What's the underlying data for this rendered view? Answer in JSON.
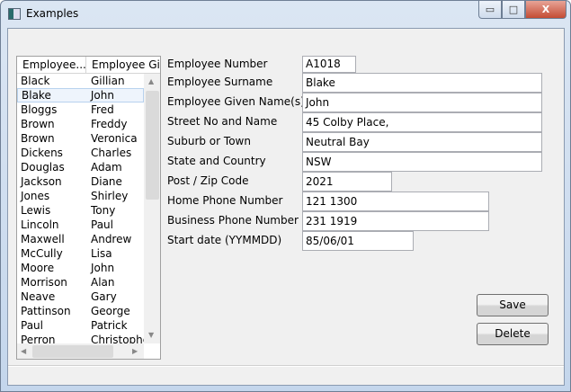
{
  "window": {
    "title": "Examples",
    "minimize": "▭",
    "maximize": "□",
    "close": "X"
  },
  "list": {
    "columns": [
      "Employee...",
      "Employee Giv..."
    ],
    "rows": [
      [
        "Black",
        "Gillian"
      ],
      [
        "Blake",
        "John"
      ],
      [
        "Bloggs",
        "Fred"
      ],
      [
        "Brown",
        "Freddy"
      ],
      [
        "Brown",
        "Veronica"
      ],
      [
        "Dickens",
        "Charles"
      ],
      [
        "Douglas",
        "Adam"
      ],
      [
        "Jackson",
        "Diane"
      ],
      [
        "Jones",
        "Shirley"
      ],
      [
        "Lewis",
        "Tony"
      ],
      [
        "Lincoln",
        "Paul"
      ],
      [
        "Maxwell",
        "Andrew"
      ],
      [
        "McCully",
        "Lisa"
      ],
      [
        "Moore",
        "John"
      ],
      [
        "Morrison",
        "Alan"
      ],
      [
        "Neave",
        "Gary"
      ],
      [
        "Pattinson",
        "George"
      ],
      [
        "Paul",
        "Patrick"
      ],
      [
        "Perron",
        "Christophe"
      ]
    ],
    "selected_index": 1
  },
  "form": {
    "fields": [
      {
        "label": "Employee Number",
        "value": "A1018"
      },
      {
        "label": "Employee Surname",
        "value": "Blake"
      },
      {
        "label": "Employee Given Name(s)",
        "value": "John"
      },
      {
        "label": "Street No and Name",
        "value": "45 Colby Place,"
      },
      {
        "label": "Suburb or Town",
        "value": "Neutral Bay"
      },
      {
        "label": "State and Country",
        "value": "NSW"
      },
      {
        "label": "Post / Zip Code",
        "value": "2021"
      },
      {
        "label": "Home Phone Number",
        "value": "121 1300"
      },
      {
        "label": "Business Phone Number",
        "value": "231 1919"
      },
      {
        "label": "Start date (YYMMDD)",
        "value": "85/06/01"
      }
    ],
    "save": "Save",
    "delete": "Delete"
  }
}
